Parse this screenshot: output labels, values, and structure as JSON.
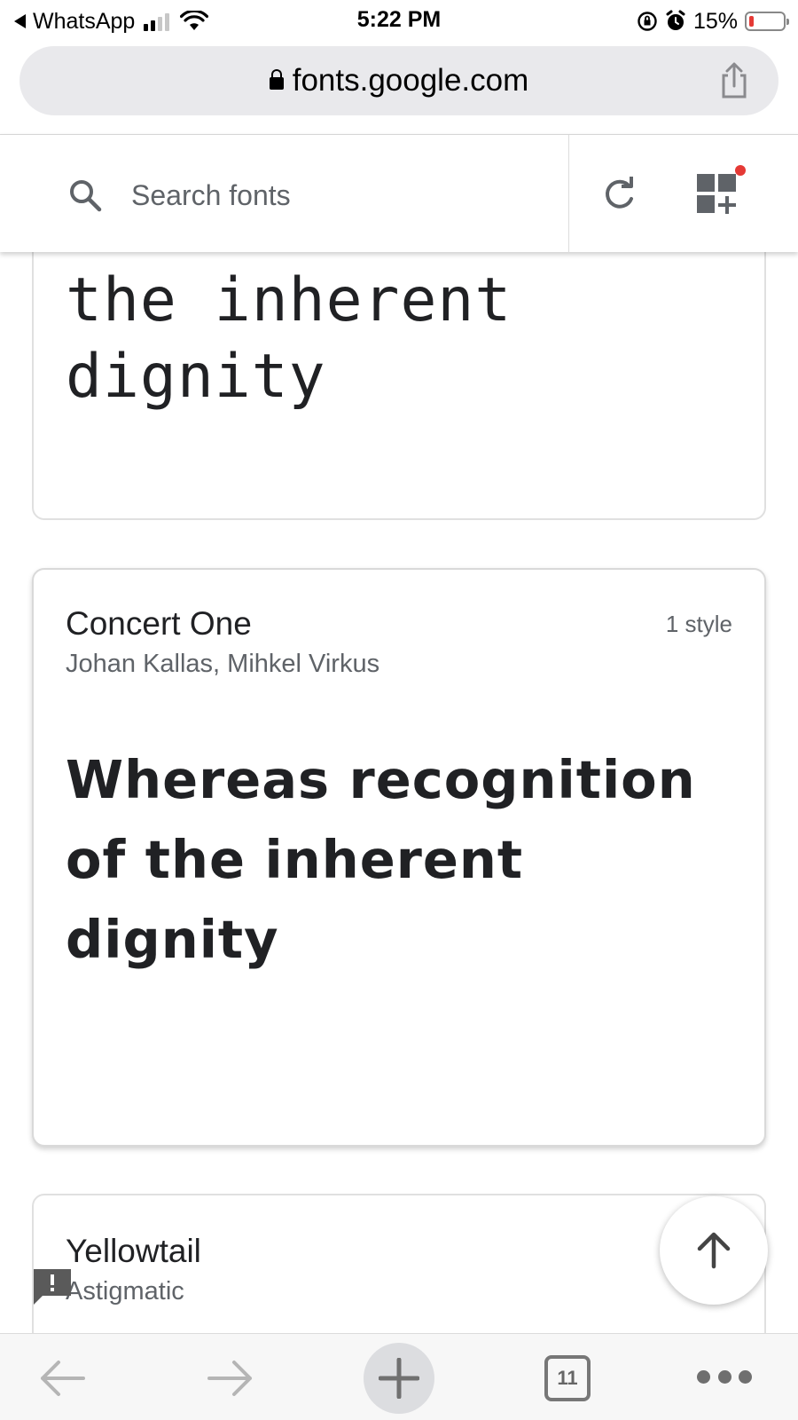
{
  "status_bar": {
    "back_app": "WhatsApp",
    "time": "5:22 PM",
    "battery": "15%",
    "battery_level": 0.15
  },
  "browser": {
    "url": "fonts.google.com"
  },
  "header": {
    "search_placeholder": "Search fonts"
  },
  "cards": [
    {
      "sample_lines": [
        "the inherent",
        "dignity"
      ]
    },
    {
      "name": "Concert One",
      "author": "Johan Kallas, Mihkel Virkus",
      "styles": "1 style",
      "sample": "Whereas recognition of the inherent dignity"
    },
    {
      "name": "Yellowtail",
      "author": "Astigmatic"
    }
  ],
  "bottom_bar": {
    "tab_count": "11"
  },
  "colors": {
    "accent_dot": "#e53935",
    "icon_gray": "#5f6368"
  },
  "icons": [
    "back-triangle-icon",
    "signal-icon",
    "wifi-icon",
    "lock-rotation-icon",
    "alarm-icon",
    "battery-icon",
    "lock-icon",
    "share-icon",
    "search-icon",
    "refresh-icon",
    "collection-add-icon",
    "feedback-icon",
    "arrow-up-icon",
    "arrow-left-icon",
    "arrow-right-icon",
    "plus-icon",
    "tabs-icon",
    "more-icon"
  ]
}
